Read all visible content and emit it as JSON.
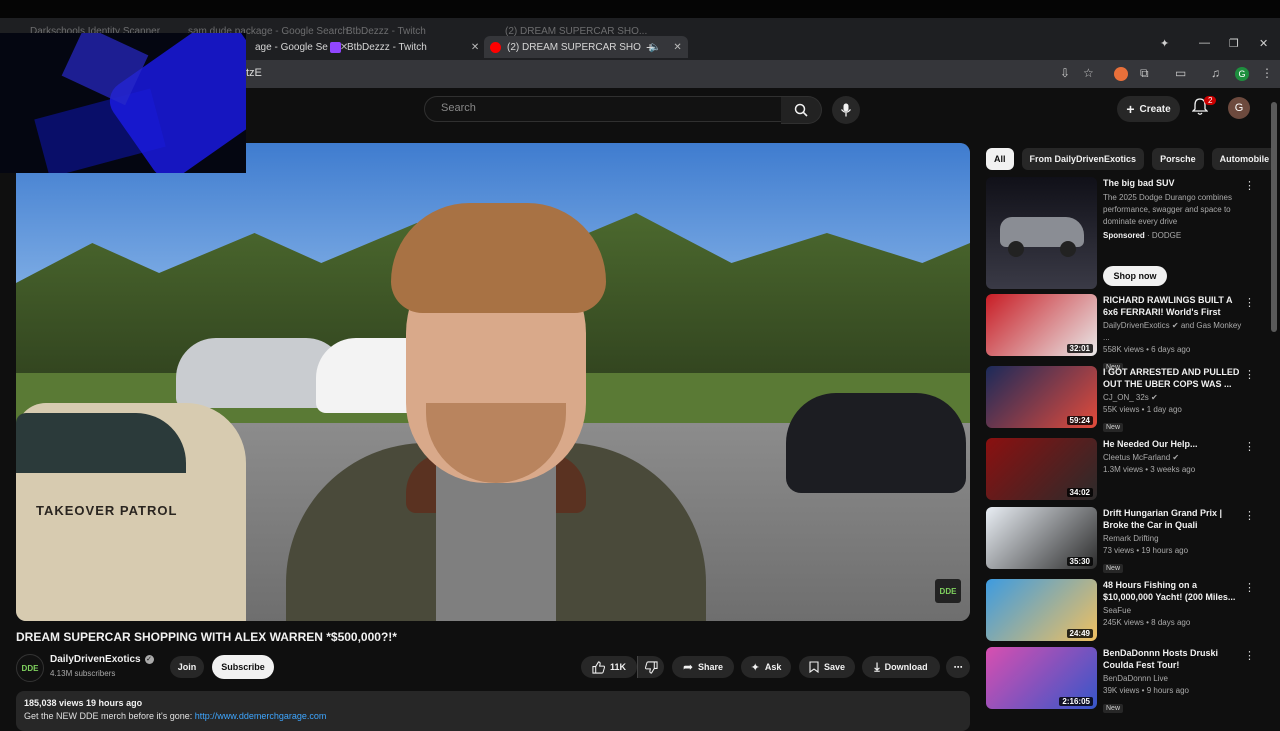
{
  "browser": {
    "ghost_tabs": [
      "Darkschools Identity Scanner",
      "sam dude package - Google Search",
      "BtbDezzz - Twitch",
      "(2) DREAM SUPERCAR SHO..."
    ],
    "tabs": [
      {
        "label": "age - Google Se",
        "favicon": "#4285f4"
      },
      {
        "label": "BtbDezzz - Twitch",
        "favicon": "#9146ff"
      },
      {
        "label": "(2) DREAM SUPERCAR SHO",
        "favicon": "#ff0000"
      }
    ],
    "new_tab": "+",
    "url_fragment": "tzE",
    "profile_initial": "G"
  },
  "header": {
    "search_placeholder": "Search",
    "create_label": "Create",
    "notif_count": "2",
    "avatar_initial": "G"
  },
  "video": {
    "title": "DREAM SUPERCAR SHOPPING WITH ALEX WARREN *$500,000?!*",
    "patrol_text": "TAKEOVER PATROL",
    "watermark": "DDE"
  },
  "channel": {
    "logo_text": "DDE",
    "name": "DailyDrivenExotics",
    "subscribers": "4.13M subscribers",
    "join_label": "Join",
    "subscribe_label": "Subscribe"
  },
  "actions": {
    "likes": "11K",
    "share": "Share",
    "ask": "Ask",
    "save": "Save",
    "download": "Download",
    "more": "⋯"
  },
  "description": {
    "meta": "185,038 views  19 hours ago",
    "line_prefix": "Get the NEW DDE merch before it's gone: ",
    "link": "http://www.ddemerchgarage.com"
  },
  "chips": [
    "All",
    "From DailyDrivenExotics",
    "Porsche",
    "Automobile"
  ],
  "ad": {
    "title": "The big bad SUV",
    "desc": "The 2025 Dodge Durango combines performance, swagger and space to dominate every drive",
    "sponsored": "Sponsored",
    "brand": "DODGE",
    "cta": "Shop now"
  },
  "recommendations": [
    {
      "title": "RICHARD RAWLINGS BUILT A 6x6 FERRARI! World's First",
      "channel": "DailyDrivenExotics ✔ and Gas Monkey ...",
      "stats": "558K views • 6 days ago",
      "new": "New",
      "duration": "32:01",
      "colors": [
        "#c81d25",
        "#e9e9e9"
      ]
    },
    {
      "title": "I GOT ARRESTED AND PULLED OUT THE UBER COPS WAS ...",
      "channel": "CJ_ON_ 32s ✔",
      "stats": "55K views • 1 day ago",
      "new": "New",
      "duration": "59:24",
      "colors": [
        "#1b2a5a",
        "#e34b3b"
      ]
    },
    {
      "title": "He Needed Our Help...",
      "channel": "Cleetus McFarland ✔",
      "stats": "1.3M views • 3 weeks ago",
      "new": "",
      "duration": "34:02",
      "colors": [
        "#8b1010",
        "#2b2b2b"
      ]
    },
    {
      "title": "Drift Hungarian Grand Prix | Broke the Car in Quali",
      "channel": "Remark Drifting",
      "stats": "73 views • 19 hours ago",
      "new": "New",
      "duration": "35:30",
      "colors": [
        "#e9eef4",
        "#2b2b2b"
      ]
    },
    {
      "title": "48 Hours Fishing on a $10,000,000 Yacht! (200 Miles...",
      "channel": "SeaFue",
      "stats": "245K views • 8 days ago",
      "new": "",
      "duration": "24:49",
      "colors": [
        "#3d9be0",
        "#f0c060"
      ]
    },
    {
      "title": "BenDaDonnn Hosts Druski Coulda Fest Tour!",
      "channel": "BenDaDonnn Live",
      "stats": "39K views • 9 hours ago",
      "new": "New",
      "duration": "2:16:05",
      "colors": [
        "#d84fb0",
        "#3556c9"
      ]
    }
  ]
}
